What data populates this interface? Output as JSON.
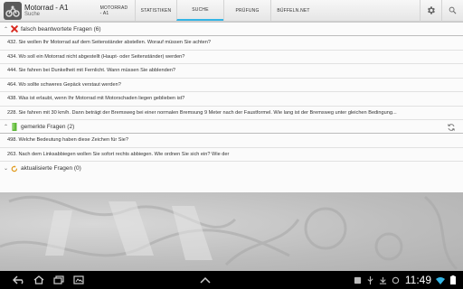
{
  "app": {
    "title": "Motorrad - A1",
    "subtitle": "Suche"
  },
  "tabs": [
    {
      "label": "MOTORRAD - A1",
      "active": false
    },
    {
      "label": "STATISTIKEN",
      "active": false
    },
    {
      "label": "SUCHE",
      "active": true
    },
    {
      "label": "PRÜFUNG",
      "active": false
    },
    {
      "label": "BÜFFELN.NET",
      "active": false
    }
  ],
  "actionbar_icons": [
    "gear-icon",
    "search-icon"
  ],
  "sections": {
    "wrong": {
      "title": "falsch beantwortete Fragen (6)",
      "icon": "red-x-icon",
      "items": [
        "432. Sie wollen Ihr Motorrad auf dem Seitenständer abstellen. Worauf müssen Sie achten?",
        "434. Wo soll ein Motorrad nicht abgestellt (Haupt- oder Seitenständer) werden?",
        "444. Sie fahren bei Dunkelheit mit Fernlicht. Wann müssen Sie abblenden?",
        "464. Wo sollte schweres Gepäck verstaut werden?",
        "438. Was ist erlaubt, wenn Ihr Motorrad mit Motorschaden liegen geblieben ist?",
        "228. Sie fahren mit 30 km/h.  Dann beträgt der Bremsweg bei einer normalen Bremsung 9 Meter nach der Faustformel. Wie lang ist der Bremsweg unter gleichen Bedingung..."
      ]
    },
    "marked": {
      "title": "gemerkte Fragen (2)",
      "icon": "green-bookmark-icon",
      "items": [
        "498. Welche Bedeutung haben diese Zeichen für Sie?",
        "263. Nach dem Linksabbiegen wollen Sie sofort rechts abbiegen.  Wie ordnen Sie sich ein?  Wie der"
      ]
    },
    "updated": {
      "title": "aktualisierte Fragen (0)",
      "icon": "refresh-orange-icon",
      "items": []
    }
  },
  "status": {
    "time": "11:49"
  },
  "colors": {
    "accent": "#33b5e5",
    "wrong": "#d9261c",
    "marked": "#5fb83a",
    "updated": "#e09a1c"
  }
}
